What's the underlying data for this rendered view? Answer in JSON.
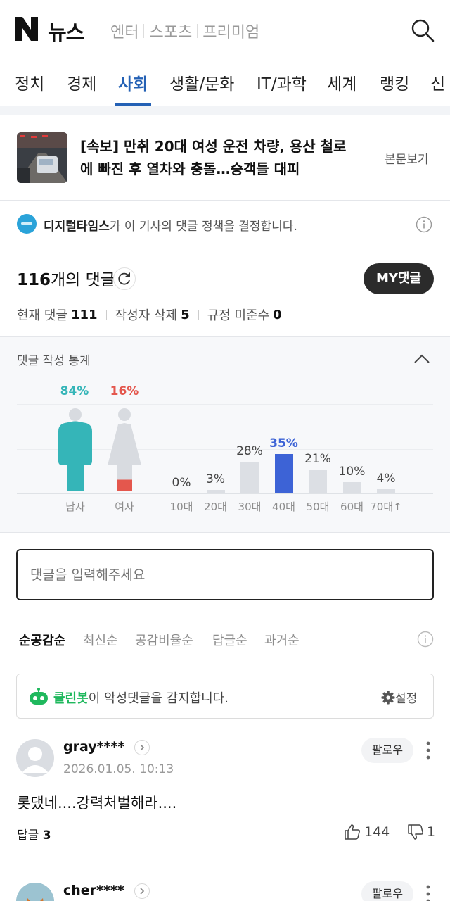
{
  "header": {
    "logo_text": "뉴스",
    "sub_nav": [
      "엔터",
      "스포츠",
      "프리미엄"
    ]
  },
  "categories": [
    "정치",
    "경제",
    "사회",
    "생활/문화",
    "IT/과학",
    "세계",
    "랭킹",
    "신"
  ],
  "active_category": "사회",
  "article": {
    "title_line1": "[속보] 만취 20대 여성 운전 차량, 용산 철로",
    "title_line2": "에 빠진 후 열차와 충돌…승객들 대피",
    "view_body": "본문보기"
  },
  "policy": {
    "press": "디지털타임스",
    "text": "가 이 기사의 댓글 정책을 결정합니다."
  },
  "comment_count": {
    "number": "116",
    "suffix": "개의 댓글",
    "my_button": "MY댓글",
    "current_label": "현재 댓글",
    "current_value": "111",
    "deleted_label": "작성자 삭제",
    "deleted_value": "5",
    "violation_label": "규정 미준수",
    "violation_value": "0"
  },
  "stats": {
    "title": "댓글 작성 통계",
    "gender": [
      {
        "label": "남자",
        "pct": "84%",
        "value": 84,
        "color": "#35b5b8"
      },
      {
        "label": "여자",
        "pct": "16%",
        "value": 16,
        "color": "#e4574d"
      }
    ],
    "ages": [
      {
        "label": "10대",
        "pct": "0%",
        "value": 0
      },
      {
        "label": "20대",
        "pct": "3%",
        "value": 3
      },
      {
        "label": "30대",
        "pct": "28%",
        "value": 28
      },
      {
        "label": "40대",
        "pct": "35%",
        "value": 35,
        "highlight": true
      },
      {
        "label": "50대",
        "pct": "21%",
        "value": 21
      },
      {
        "label": "60대",
        "pct": "10%",
        "value": 10
      },
      {
        "label": "70대↑",
        "pct": "4%",
        "value": 4
      }
    ],
    "colors": {
      "age_bar": "#dcdfe4",
      "age_highlight": "#3d63d6"
    }
  },
  "comment_input": {
    "placeholder": "댓글을 입력해주세요"
  },
  "sort": {
    "items": [
      "순공감순",
      "최신순",
      "공감비율순",
      "답글순",
      "과거순"
    ],
    "active": "순공감순"
  },
  "cleanbot": {
    "name": "클린봇",
    "text": "이 악성댓글을 감지합니다.",
    "settings": "설정"
  },
  "comments": [
    {
      "user": "gray****",
      "date": "2026.01.05. 10:13",
      "follow": "팔로우",
      "text": "롯댔네....강력처벌해라....",
      "reply_label": "답글",
      "reply_count": "3",
      "likes": "144",
      "dislikes": "1"
    },
    {
      "user": "cher****",
      "follow": "팔로우"
    }
  ]
}
